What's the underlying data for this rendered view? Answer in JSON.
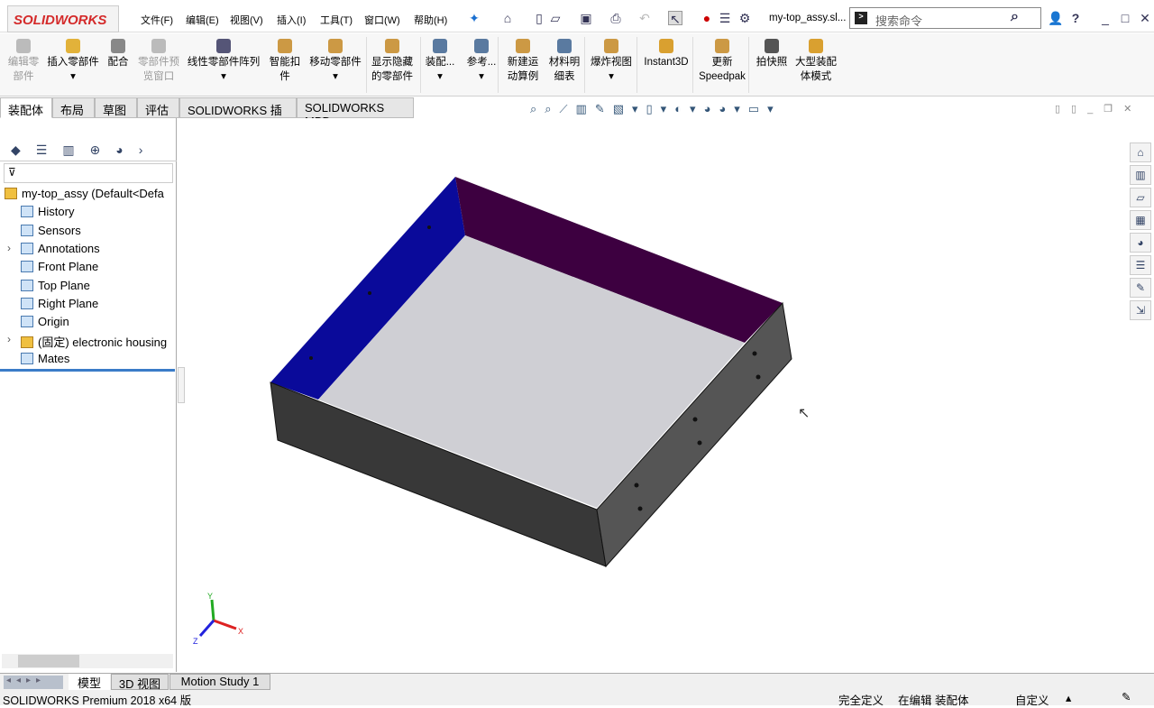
{
  "app": {
    "logo": "SOLIDWORKS",
    "doc_title": "my-top_assy.sl...",
    "search_placeholder": "搜索命令"
  },
  "menu": [
    "文件(F)",
    "编辑(E)",
    "视图(V)",
    "插入(I)",
    "工具(T)",
    "窗口(W)",
    "帮助(H)"
  ],
  "ribbon": [
    {
      "label": "编辑零\n部件",
      "disabled": true
    },
    {
      "label": "插入零部件\n▾"
    },
    {
      "label": "配合"
    },
    {
      "label": "零部件预\n览窗口",
      "disabled": true
    },
    {
      "label": "线性零部件阵列\n▾"
    },
    {
      "label": "智能扣\n件"
    },
    {
      "label": "移动零部件\n▾"
    },
    {
      "label": "显示隐藏\n的零部件"
    },
    {
      "label": "装配...\n▾"
    },
    {
      "label": "参考...\n▾"
    },
    {
      "label": "新建运\n动算例"
    },
    {
      "label": "材料明\n细表"
    },
    {
      "label": "爆炸视图\n▾"
    },
    {
      "label": "Instant3D"
    },
    {
      "label": "更新\nSpeedpak"
    },
    {
      "label": "拍快照"
    },
    {
      "label": "大型装配\n体模式"
    }
  ],
  "tabs": [
    "装配体",
    "布局",
    "草图",
    "评估",
    "SOLIDWORKS 插件",
    "SOLIDWORKS MBD"
  ],
  "tree": [
    {
      "label": "my-top_assy  (Default<Defa",
      "icon": "assembly-icon"
    },
    {
      "label": "History",
      "icon": "history-icon"
    },
    {
      "label": "Sensors",
      "icon": "sensor-icon"
    },
    {
      "label": "Annotations",
      "icon": "annotation-icon",
      "expandable": true
    },
    {
      "label": "Front Plane",
      "icon": "plane-icon"
    },
    {
      "label": "Top Plane",
      "icon": "plane-icon"
    },
    {
      "label": "Right Plane",
      "icon": "plane-icon"
    },
    {
      "label": "Origin",
      "icon": "origin-icon"
    },
    {
      "label": "(固定) electronic housing",
      "icon": "part-icon",
      "expandable": true
    },
    {
      "label": "Mates",
      "icon": "mates-icon"
    }
  ],
  "bottom_tabs": [
    "模型",
    "3D 视图",
    "Motion Study 1"
  ],
  "status": {
    "product": "SOLIDWORKS Premium 2018 x64 版",
    "defined": "完全定义",
    "editing": "在编辑 装配体",
    "units": "自定义"
  },
  "colors": {
    "inner_left": "#0a0a9a",
    "inner_back": "#3d0040",
    "floor": "#cfcfd4",
    "outer": "#3a3a3a",
    "accent": "#d42a2a"
  }
}
